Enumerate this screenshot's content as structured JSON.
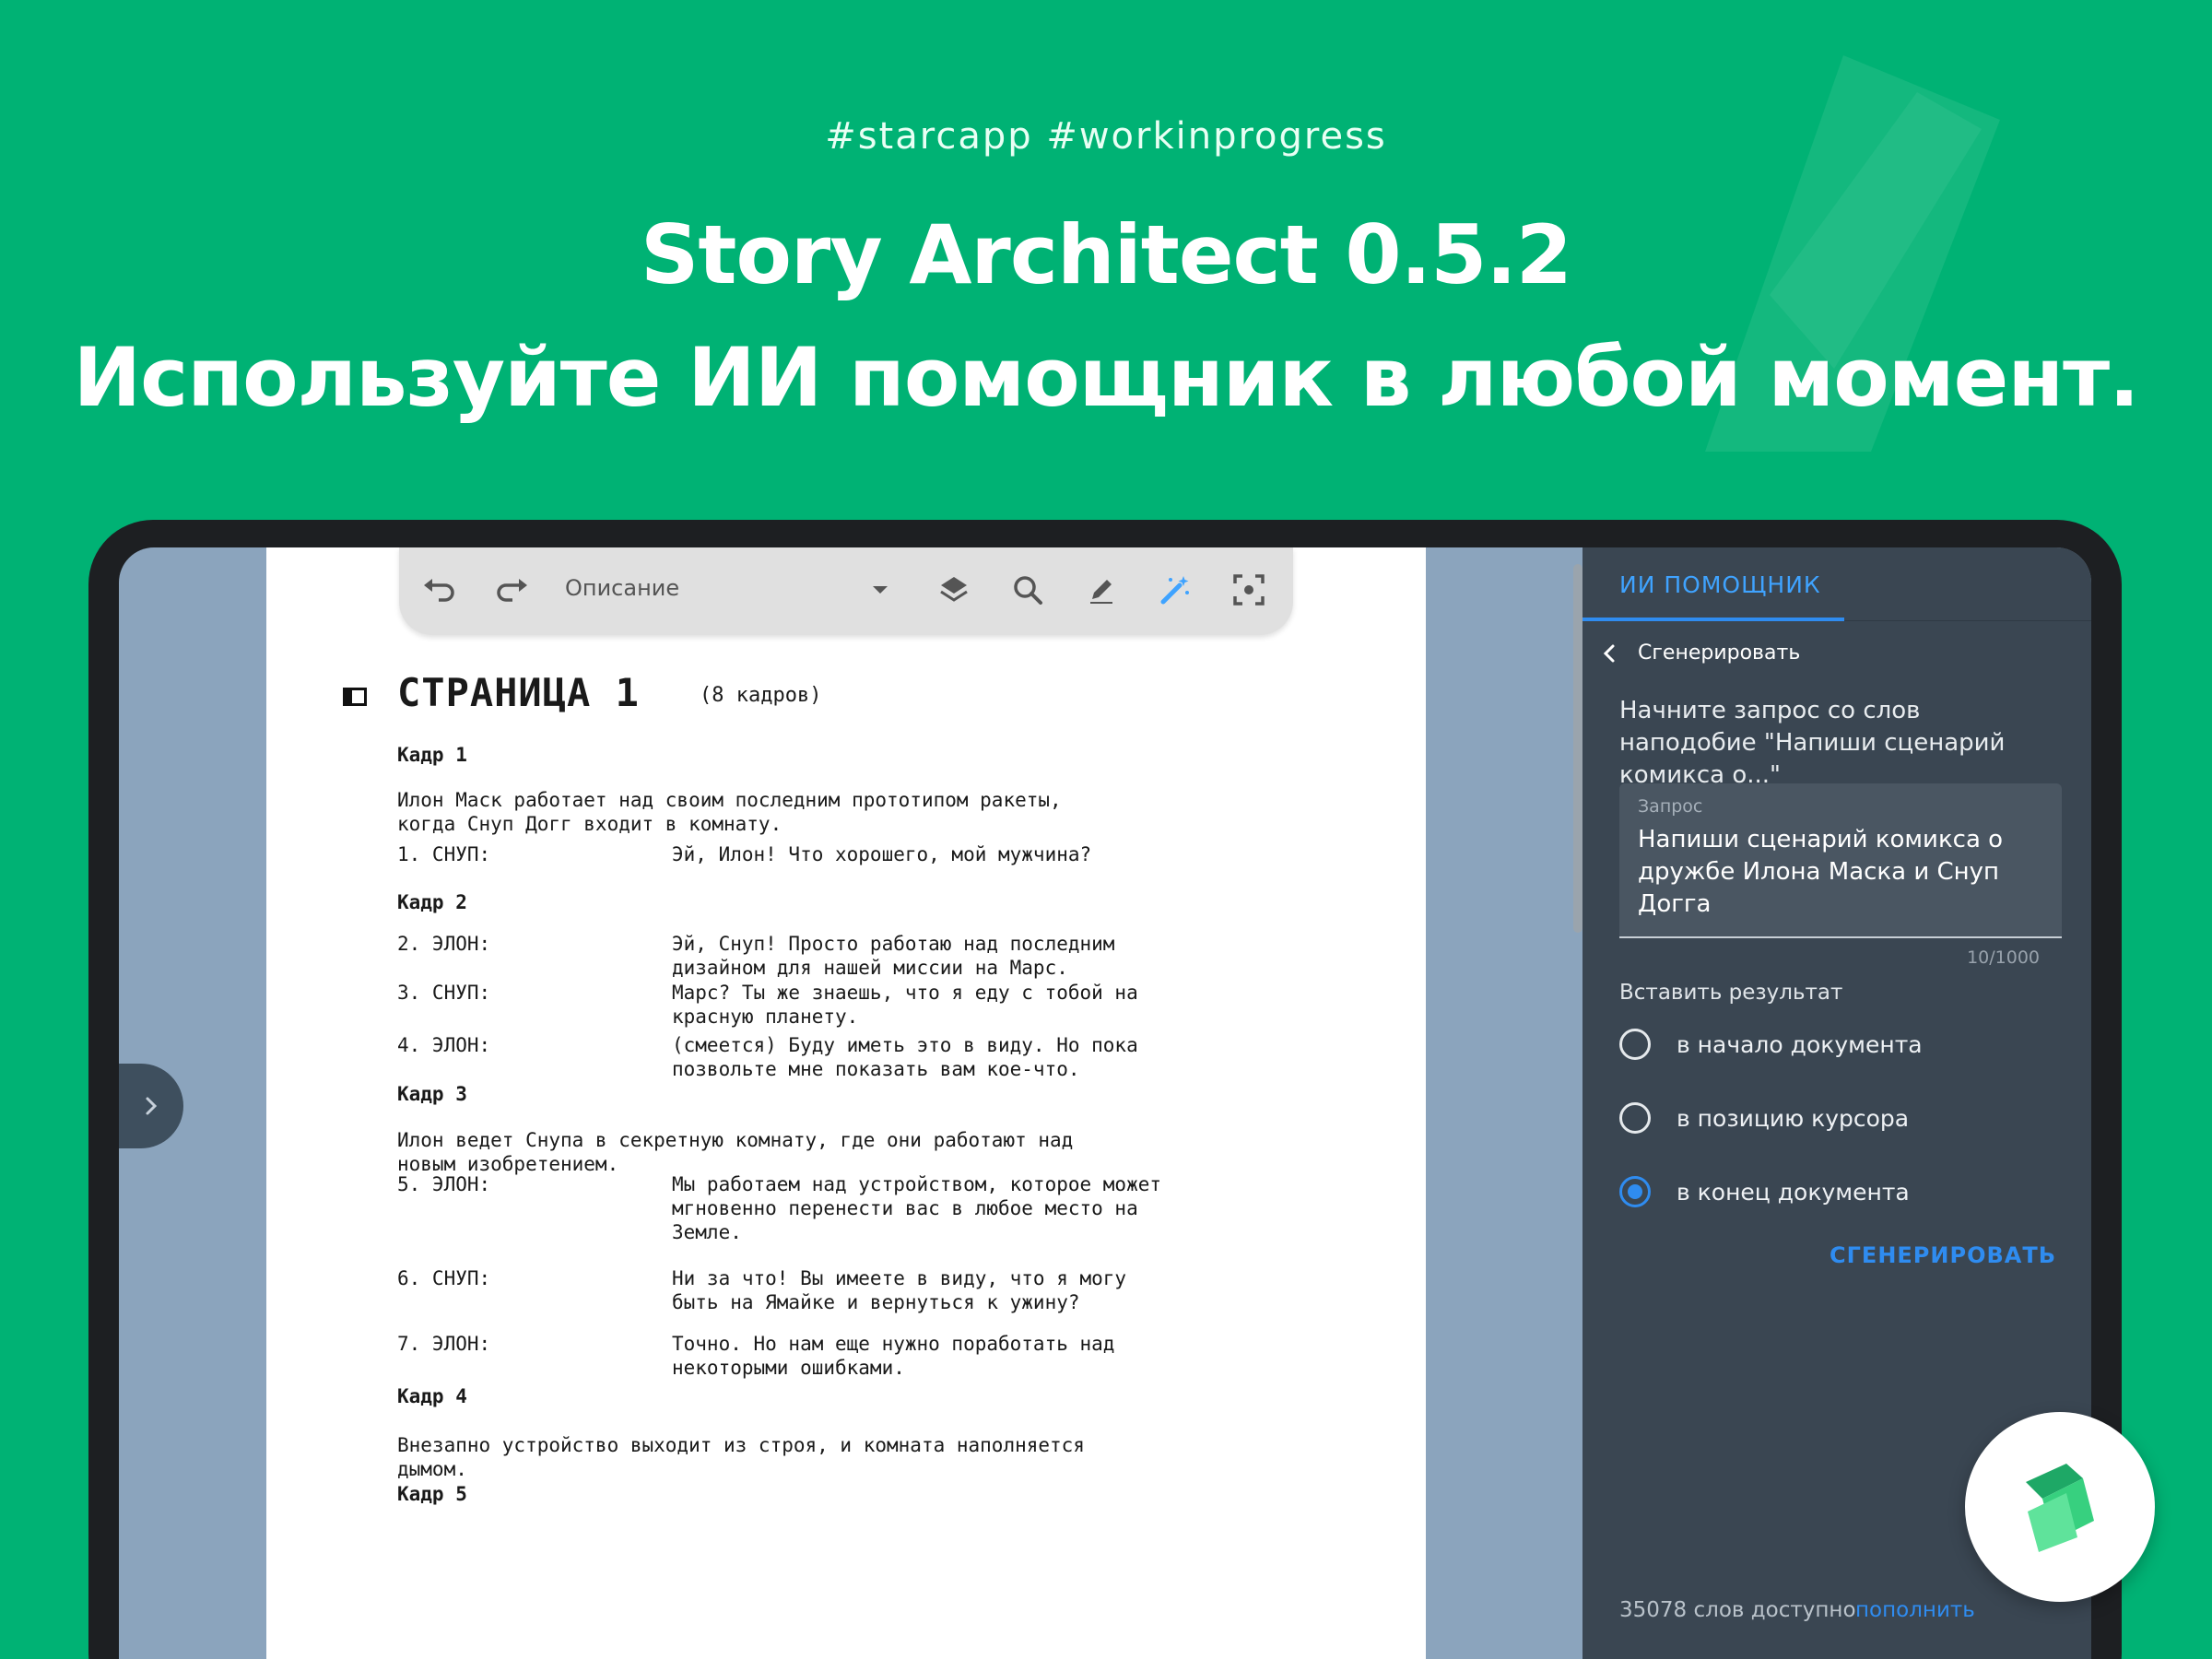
{
  "banner": {
    "hashtags": "#starcapp  #workinprogress",
    "title": "Story Architect 0.5.2",
    "subtitle": "Используйте ИИ помощник в любой момент."
  },
  "toolbar": {
    "paragraph_type": "Описание",
    "icons": [
      "undo-icon",
      "redo-icon",
      "dropdown-arrow-icon",
      "layers-icon",
      "search-icon",
      "pen-icon",
      "magic-wand-icon",
      "focus-icon"
    ]
  },
  "script": {
    "page_heading": "СТРАНИЦА 1",
    "page_count": "(8 кадров)",
    "lines": [
      {
        "kind": "frame",
        "text": "Кадр 1"
      },
      {
        "kind": "action",
        "text": "Илон Маск работает над своим последним прототипом ракеты,\nкогда Снуп Догг входит в комнату."
      },
      {
        "kind": "dialog",
        "speaker": "1. СНУП:",
        "text": "Эй, Илон! Что хорошего, мой мужчина?"
      },
      {
        "kind": "frame",
        "text": "Кадр 2"
      },
      {
        "kind": "dialog",
        "speaker": "2. ЭЛОН:",
        "text": "Эй, Снуп! Просто работаю над последним\nдизайном для нашей миссии на Марс."
      },
      {
        "kind": "dialog",
        "speaker": "3. СНУП:",
        "text": "Марс? Ты же знаешь, что я еду с тобой на\nкрасную планету."
      },
      {
        "kind": "dialog",
        "speaker": "4. ЭЛОН:",
        "text": "(смеется) Буду иметь это в виду. Но пока\nпозвольте мне показать вам кое-что."
      },
      {
        "kind": "frame",
        "text": "Кадр 3"
      },
      {
        "kind": "action",
        "text": "Илон ведет Снупа в секретную комнату, где они работают над\nновым изобретением."
      },
      {
        "kind": "dialog",
        "speaker": "5. ЭЛОН:",
        "text": "Мы работаем над устройством, которое может\nмгновенно перенести вас в любое место на\nЗемле."
      },
      {
        "kind": "dialog",
        "speaker": "6. СНУП:",
        "text": "Ни за что! Вы имеете в виду, что я могу\nбыть на Ямайке и вернуться к ужину?"
      },
      {
        "kind": "dialog",
        "speaker": "7. ЭЛОН:",
        "text": "Точно. Но нам еще нужно поработать над\nнекоторыми ошибками."
      },
      {
        "kind": "frame",
        "text": "Кадр 4"
      },
      {
        "kind": "action",
        "text": "Внезапно устройство выходит из строя, и комната наполняется\nдымом."
      },
      {
        "kind": "frame",
        "text": "Кадр 5"
      }
    ]
  },
  "panel": {
    "tab": "ИИ ПОМОЩНИК",
    "back_label": "Сгенерировать",
    "hint": "Начните запрос со слов наподобие \"Напиши сценарий комикса о...\"",
    "query_label": "Запрос",
    "query_value": "Напиши сценарий комикса о дружбе Илона Маска и Снуп Догга",
    "counter": "10/1000",
    "insert_label": "Вставить результат",
    "options": [
      {
        "label": "в начало документа",
        "checked": false
      },
      {
        "label": "в позицию курсора",
        "checked": false
      },
      {
        "label": "в конец документа",
        "checked": true
      }
    ],
    "generate_button": "СГЕНЕРИРОВАТЬ",
    "words_available": "35078 слов доступно",
    "refill_link": "пополнить"
  },
  "colors": {
    "background": "#00b274",
    "accent": "#2f8cf0",
    "panel": "#3a4652",
    "page_margin": "#8ba4bd"
  }
}
